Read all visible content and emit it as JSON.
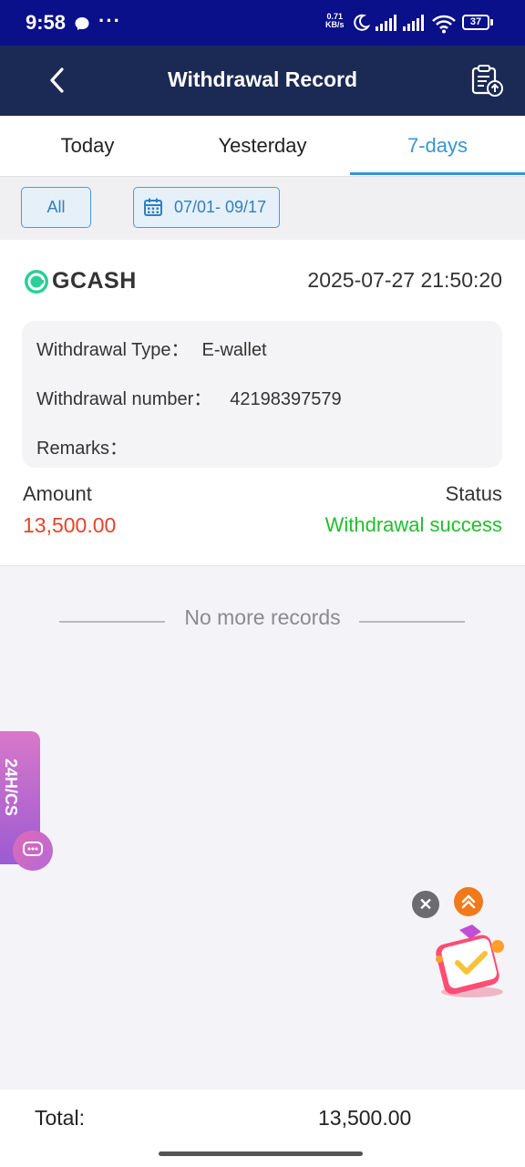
{
  "status_bar": {
    "time": "9:58",
    "net_speed": "0.71",
    "net_unit": "KB/s",
    "battery": "37"
  },
  "header": {
    "title": "Withdrawal Record"
  },
  "tabs": [
    {
      "label": "Today"
    },
    {
      "label": "Yesterday"
    },
    {
      "label": "7-days"
    }
  ],
  "active_tab": "7-days",
  "filter": {
    "all_label": "All",
    "date_range": "07/01- 09/17"
  },
  "record": {
    "provider": "GCASH",
    "datetime": "2025-07-27 21:50:20",
    "type_label": "Withdrawal Type：",
    "type_value": "E-wallet",
    "number_label": "Withdrawal number：",
    "number_value": "42198397579",
    "remarks_label": "Remarks：",
    "amount_label": "Amount",
    "amount_value": "13,500.00",
    "status_label": "Status",
    "status_value": "Withdrawal success"
  },
  "no_more_text": "No more records",
  "side_tab": {
    "label": "24H/CS"
  },
  "footer": {
    "total_label": "Total:",
    "total_value": "13,500.00"
  },
  "colors": {
    "header_bg": "#1b2a54",
    "accent": "#3596d6",
    "amount": "#e2452a",
    "success": "#1fbf2a"
  }
}
